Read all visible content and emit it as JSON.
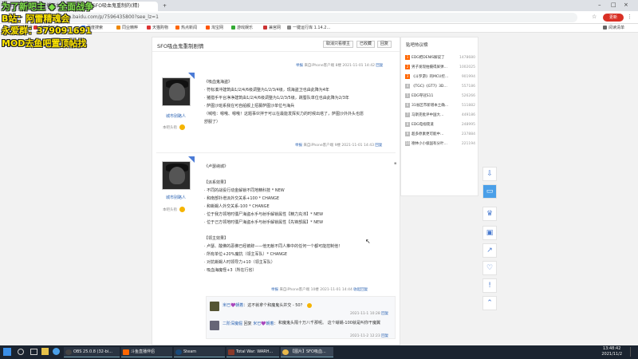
{
  "browser": {
    "tabs": [
      {
        "label": "斗鱼 - 每个人的直播平台",
        "active": false
      },
      {
        "label": "【图片】SFO吸血鬼重制的(精)",
        "active": true
      }
    ],
    "new_tab": "+",
    "url": "tieba.baidu.com/p/7596435800?see_lz=1",
    "window_controls": {
      "minimize": "–",
      "maximize": "□",
      "close": "×"
    },
    "update_label": "更新",
    "bookmarks": [
      "应用",
      "百度",
      "电脑爱好者",
      "百度搜索",
      "同业精粹",
      "天猫购物",
      "热点新闻",
      "淘宝网",
      "游戏娱乐",
      "兼宫网",
      "一键运行库 1.14.2..."
    ],
    "reading_list": "阅读清单"
  },
  "thread": {
    "title": "SFO吸血鬼重制剧情",
    "buttons": [
      "取消只看楼主",
      "已收藏",
      "回复"
    ]
  },
  "posts": [
    {
      "meta": {
        "link": "举报",
        "client": "来自iPhone客户端",
        "floor": "8楼",
        "time": "2021-11-01 14:42",
        "reply": "回复"
      },
      "user": {
        "name": "城市别路人",
        "level": "本吧头衔"
      },
      "lines": [
        "《吸血鬼海盗》",
        "· 符标凑冲建筑由1/2/4/6级调整为1/2/3/4级，现海盗卫也由此降为4年",
        "· 猪猎手平台净净建筑由1/2/4/6级调整为1/2/3/5级，跳蜀队单位也由此降为2/3年",
        "· 萨图沙班系我在可自船舰上招募萨图沙单位与海兵",
        "（喊啦：嗯哦、嗯哦！这题事伙拌于可以在最能发挥实力的时候出塔了，萨图沙外外头也愿",
        "舒服了）"
      ]
    },
    {
      "meta": {
        "link": "举报",
        "client": "来自iPhone客户端",
        "floor": "9楼",
        "time": "2021-11-01 14:43",
        "reply": "回复"
      },
      "user": {
        "name": "城市别路人",
        "level": "本吧头衔"
      },
      "lines": [
        "《卢瑟纳城》",
        "",
        "【派系效果】",
        "· 不同的战役行动金解锁不同地精科技 * NEW",
        "· 和南部扑增派外交关系+100 * CHANGE",
        "· 和蜥蜴人外交关系-100 * CHANGE",
        "· 位于我方领地时僵尸海盗水手与射手解锁属性【精力充沛】* NEW",
        "· 位于己方领地时僵尸海盗水手与射手解锁属性【先锋部属】* NEW",
        "",
        "【领主效果】",
        "· 卢瑟、酸佛的恶佛已经被辞——他无献不同人推中的任何一个都可能控制他！",
        "· 所有单位+20%魔抗（领主军队）* CHANGE",
        "· 对抗蜥蜴人时领导力+10（领主军队）",
        "· 吸血海魔怪+3（所在行省）"
      ]
    }
  ],
  "post3_meta": {
    "link": "举报",
    "client": "来自iPhone客户端",
    "floor": "10楼",
    "time": "2021-11-01 14:44",
    "reply": "收起回复"
  },
  "replies": [
    {
      "user": "米已💜朝着",
      "text": "这不就拿个和魔鬼头并交 - 50？",
      "time": "2021-11-1 10:28",
      "reply": "回复"
    },
    {
      "user": "二阶深魔倔",
      "mid": "回复",
      "user2": "米已💜朝着",
      "text": "和魔鬼头隔十万八千那呢。 这个蜥蜴-100就是叫你干魔翼",
      "time": "2021-11-2 12:23",
      "reply": "回复"
    }
  ],
  "sidebar": {
    "title": "贴吧热议榜",
    "items": [
      {
        "rank": "1",
        "title": "EDG把DENIS解说了",
        "num": "1478680"
      },
      {
        "rank": "2",
        "title": "男子发现拍摄得屏弹…",
        "num": "1002025"
      },
      {
        "rank": "3",
        "title": "《斗罗游》的MCU控…",
        "num": "901994"
      },
      {
        "rank": "4",
        "title": "《TGC》《GT7》3D…",
        "num": "557186"
      },
      {
        "rank": "5",
        "title": "EDG夺冠S11",
        "num": "526266"
      },
      {
        "rank": "6",
        "title": "31省区市新增本土确…",
        "num": "511882"
      },
      {
        "rank": "7",
        "title": "马斯克批评中国大…",
        "num": "449186"
      },
      {
        "rank": "8",
        "title": "EDG电视夜道",
        "num": "248995"
      },
      {
        "rank": "9",
        "title": "超多原素更可能中…",
        "num": "237884"
      },
      {
        "rank": "10",
        "title": "德林小小极国有分叶…",
        "num": "221194"
      }
    ]
  },
  "right_tools": [
    "download-icon",
    "chat-icon",
    "gift-icon",
    "display-icon",
    "share-icon",
    "heart-icon",
    "flag-icon",
    "up-arrow-icon"
  ],
  "right_tool_glyphs": [
    "⇩",
    "▭",
    "♛",
    "▣",
    "↗",
    "♡",
    "!",
    "⌃"
  ],
  "taskbar": {
    "items": [
      "OBS 25.0.8 (32-bi...",
      "斗鱼直播伴侣",
      "Steam",
      "Total War: WARH...",
      "【图片】SFO吸血..."
    ],
    "time": "13:48:42",
    "date": "2021/11/2"
  },
  "overlays": {
    "line1": "为了新吧主 ◆ 全面战争",
    "line2": "B站：阿雷精魂会",
    "line3": "永爱群：379091691",
    "line4": "MOD去鱼吧置顶帖找"
  },
  "colors": {
    "accent": "#2d64b3",
    "rank_hot": "#ff6600",
    "overlay_text": "#ffe600",
    "taskbar": "#1b2430"
  }
}
